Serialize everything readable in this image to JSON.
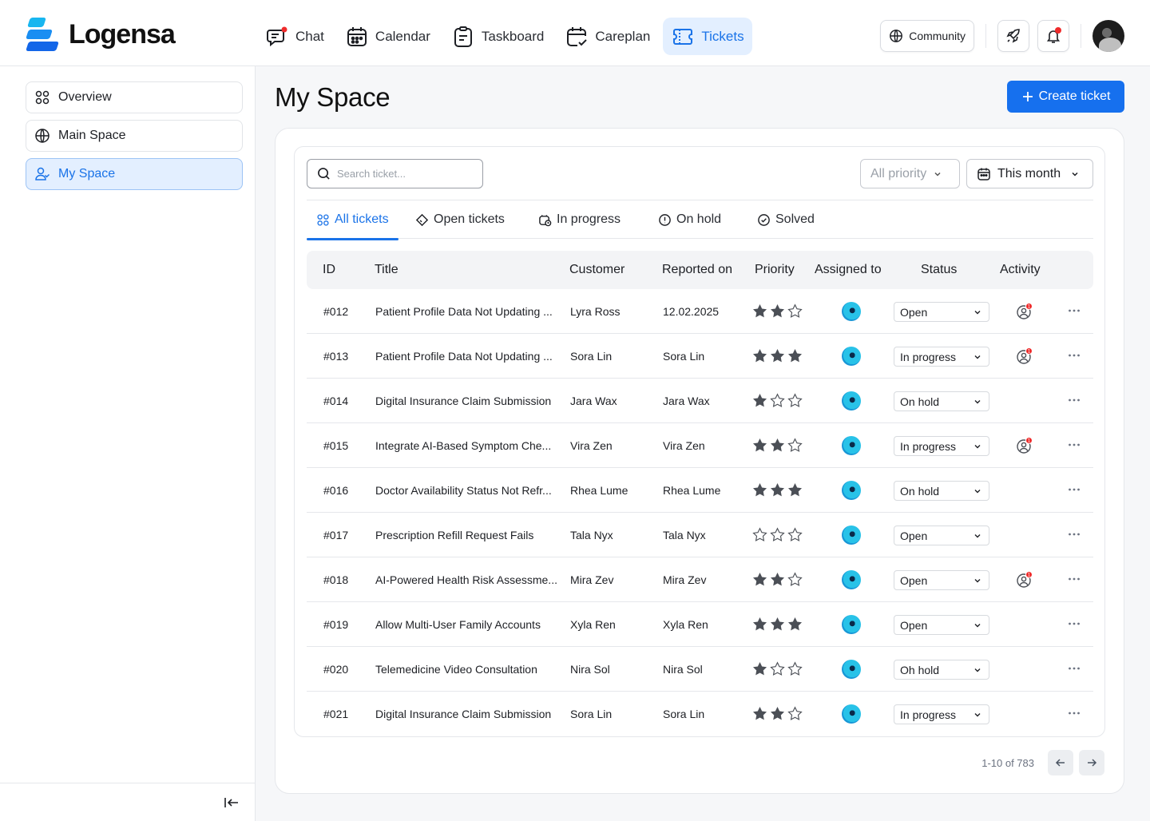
{
  "app": {
    "name": "Logensa"
  },
  "nav": [
    {
      "label": "Chat",
      "icon": "chat-icon"
    },
    {
      "label": "Calendar",
      "icon": "calendar-icon"
    },
    {
      "label": "Taskboard",
      "icon": "clipboard-icon"
    },
    {
      "label": "Careplan",
      "icon": "calendar-check-icon"
    },
    {
      "label": "Tickets",
      "icon": "ticket-icon",
      "active": true
    }
  ],
  "header": {
    "community_label": "Community"
  },
  "sidebar": {
    "items": [
      {
        "label": "Overview",
        "icon": "grid-icon"
      },
      {
        "label": "Main Space",
        "icon": "globe-icon"
      },
      {
        "label": "My Space",
        "icon": "users-icon",
        "active": true
      }
    ]
  },
  "main": {
    "title": "My Space",
    "create_label": "Create ticket",
    "search_placeholder": "Search ticket...",
    "priority_filter": "All priority",
    "date_filter": "This month",
    "tabs": [
      {
        "label": "All tickets",
        "active": true
      },
      {
        "label": "Open tickets"
      },
      {
        "label": "In progress"
      },
      {
        "label": "On hold"
      },
      {
        "label": "Solved"
      }
    ],
    "columns": [
      "ID",
      "Title",
      "Customer",
      "Reported on",
      "Priority",
      "Assigned to",
      "Status",
      "Activity"
    ],
    "rows": [
      {
        "id": "#012",
        "title": "Patient Profile Data Not Updating ...",
        "customer": "Lyra Ross",
        "reported": "12.02.2025",
        "priority": 2,
        "status": "Open",
        "activity": 1
      },
      {
        "id": "#013",
        "title": "Patient Profile Data Not Updating ...",
        "customer": "Sora Lin",
        "reported": "Sora Lin",
        "priority": 3,
        "status": "In progress",
        "activity": 1
      },
      {
        "id": "#014",
        "title": "Digital Insurance Claim Submission",
        "customer": "Jara Wax",
        "reported": "Jara Wax",
        "priority": 1,
        "status": "On hold",
        "activity": 0
      },
      {
        "id": "#015",
        "title": "Integrate AI-Based Symptom Che...",
        "customer": "Vira Zen",
        "reported": "Vira Zen",
        "priority": 2,
        "status": "In progress",
        "activity": 1
      },
      {
        "id": "#016",
        "title": "Doctor Availability Status Not Refr...",
        "customer": "Rhea Lume",
        "reported": "Rhea Lume",
        "priority": 3,
        "status": "On hold",
        "activity": 0
      },
      {
        "id": "#017",
        "title": "Prescription Refill Request Fails",
        "customer": "Tala Nyx",
        "reported": "Tala Nyx",
        "priority": 0,
        "status": "Open",
        "activity": 0
      },
      {
        "id": "#018",
        "title": "AI-Powered Health Risk Assessme...",
        "customer": "Mira Zev",
        "reported": "Mira Zev",
        "priority": 2,
        "status": "Open",
        "activity": 1
      },
      {
        "id": "#019",
        "title": "Allow Multi-User Family Accounts",
        "customer": "Xyla Ren",
        "reported": "Xyla Ren",
        "priority": 3,
        "status": "Open",
        "activity": 0
      },
      {
        "id": "#020",
        "title": "Telemedicine Video Consultation",
        "customer": "Nira Sol",
        "reported": "Nira Sol",
        "priority": 1,
        "status": "Oh hold",
        "activity": 0
      },
      {
        "id": "#021",
        "title": "Digital Insurance Claim Submission",
        "customer": "Sora Lin",
        "reported": "Sora Lin",
        "priority": 2,
        "status": "In progress",
        "activity": 0
      }
    ],
    "pagination": {
      "label": "1-10 of 783"
    }
  },
  "colors": {
    "accent": "#1670ee",
    "active_bg": "#e3efff",
    "star": "#4b4f56",
    "badge": "#ef2b2b"
  }
}
